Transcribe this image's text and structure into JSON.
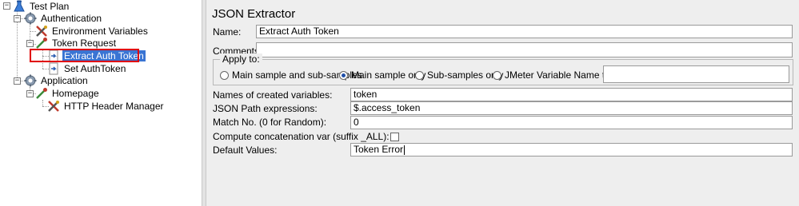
{
  "tree": {
    "test_plan": "Test Plan",
    "authentication": "Authentication",
    "environment_variables": "Environment Variables",
    "token_request": "Token Request",
    "extract_auth_token": "Extract Auth Token",
    "set_auth_token": "Set AuthToken",
    "application": "Application",
    "homepage": "Homepage",
    "http_header_manager": "HTTP Header Manager"
  },
  "panel": {
    "title": "JSON Extractor",
    "name_label": "Name:",
    "name_value": "Extract Auth Token",
    "comments_label": "Comments:",
    "comments_value": "",
    "apply_to_label": "Apply to:",
    "apply_options": [
      "Main sample and sub-samples",
      "Main sample only",
      "Sub-samples only",
      "JMeter Variable Name to use"
    ],
    "apply_selected": "Main sample only",
    "jmeter_var_value": "",
    "names_label": "Names of created variables:",
    "names_value": "token",
    "json_path_label": "JSON Path expressions:",
    "json_path_value": "$.access_token",
    "match_no_label": "Match No. (0 for Random):",
    "match_no_value": "0",
    "compute_label": "Compute concatenation var (suffix _ALL):",
    "compute_checked": false,
    "default_label": "Default Values:",
    "default_value": "Token Error"
  },
  "colors": {
    "selection": "#3a74d3",
    "highlight_box": "#e00000"
  }
}
